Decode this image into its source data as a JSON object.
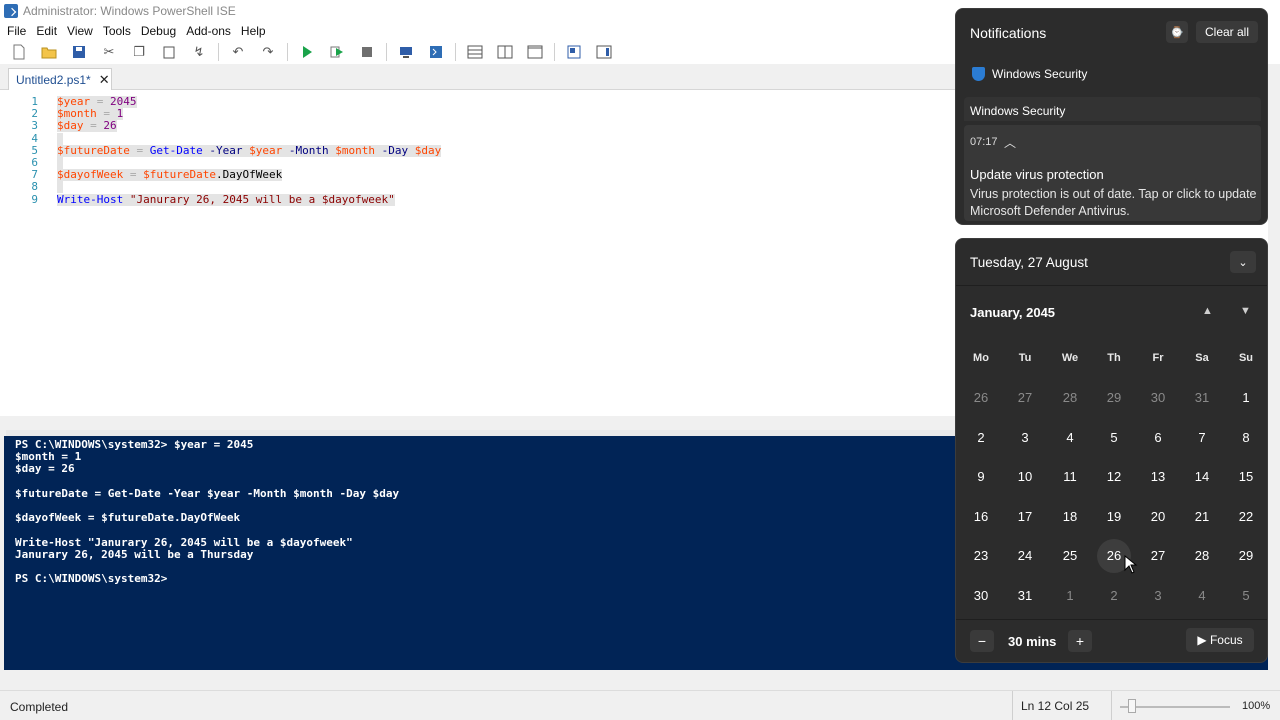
{
  "window": {
    "title": "Administrator: Windows PowerShell ISE"
  },
  "menu": [
    "File",
    "Edit",
    "View",
    "Tools",
    "Debug",
    "Add-ons",
    "Help"
  ],
  "tab": {
    "label": "Untitled2.ps1*",
    "close": "✕"
  },
  "editor": {
    "lines": [
      {
        "n": "1",
        "tokens": [
          [
            "var",
            "$year"
          ],
          [
            "op",
            " = "
          ],
          [
            "num",
            "2045"
          ]
        ]
      },
      {
        "n": "2",
        "tokens": [
          [
            "var",
            "$month"
          ],
          [
            "op",
            " = "
          ],
          [
            "num",
            "1"
          ]
        ]
      },
      {
        "n": "3",
        "tokens": [
          [
            "var",
            "$day"
          ],
          [
            "op",
            " = "
          ],
          [
            "num",
            "26"
          ]
        ]
      },
      {
        "n": "4",
        "tokens": []
      },
      {
        "n": "5",
        "tokens": [
          [
            "var",
            "$futureDate"
          ],
          [
            "op",
            " = "
          ],
          [
            "cmd",
            "Get-Date"
          ],
          [
            "op",
            " "
          ],
          [
            "par",
            "-Year"
          ],
          [
            "op",
            " "
          ],
          [
            "var",
            "$year"
          ],
          [
            "op",
            " "
          ],
          [
            "par",
            "-Month"
          ],
          [
            "op",
            " "
          ],
          [
            "var",
            "$month"
          ],
          [
            "op",
            " "
          ],
          [
            "par",
            "-Day"
          ],
          [
            "op",
            " "
          ],
          [
            "var",
            "$day"
          ]
        ]
      },
      {
        "n": "6",
        "tokens": []
      },
      {
        "n": "7",
        "tokens": [
          [
            "var",
            "$dayofWeek"
          ],
          [
            "op",
            " = "
          ],
          [
            "var",
            "$futureDate"
          ],
          [
            "mem",
            ".DayOfWeek"
          ]
        ]
      },
      {
        "n": "8",
        "tokens": []
      },
      {
        "n": "9",
        "tokens": [
          [
            "cmd",
            "Write-Host"
          ],
          [
            "op",
            " "
          ],
          [
            "str",
            "\"Janurary 26, 2045 will be a $dayofweek\""
          ]
        ]
      }
    ]
  },
  "console": {
    "lines": [
      "PS C:\\WINDOWS\\system32> $year = 2045",
      "$month = 1",
      "$day = 26",
      "",
      "$futureDate = Get-Date -Year $year -Month $month -Day $day",
      "",
      "$dayofWeek = $futureDate.DayOfWeek",
      "",
      "Write-Host \"Janurary 26, 2045 will be a $dayofweek\"",
      "Janurary 26, 2045 will be a Thursday",
      "",
      "PS C:\\WINDOWS\\system32>"
    ]
  },
  "status": {
    "text": "Completed",
    "position": "Ln 12  Col 25",
    "zoom": "100%"
  },
  "notifications": {
    "title": "Notifications",
    "clear_all": "Clear all",
    "app_name": "Windows Security",
    "group_label": "Windows Security",
    "time": "07:17",
    "heading": "Update virus protection",
    "body": "Virus protection is out of date. Tap or click to update Microsoft Defender Antivirus."
  },
  "calendar": {
    "date_header": "Tuesday, 27 August",
    "month_label": "January, 2045",
    "weekdays": [
      "Mo",
      "Tu",
      "We",
      "Th",
      "Fr",
      "Sa",
      "Su"
    ],
    "weeks": [
      [
        [
          "26",
          0
        ],
        [
          "27",
          0
        ],
        [
          "28",
          0
        ],
        [
          "29",
          0
        ],
        [
          "30",
          0
        ],
        [
          "31",
          0
        ],
        [
          "1",
          1
        ]
      ],
      [
        [
          "2",
          1
        ],
        [
          "3",
          1
        ],
        [
          "4",
          1
        ],
        [
          "5",
          1
        ],
        [
          "6",
          1
        ],
        [
          "7",
          1
        ],
        [
          "8",
          1
        ]
      ],
      [
        [
          "9",
          1
        ],
        [
          "10",
          1
        ],
        [
          "11",
          1
        ],
        [
          "12",
          1
        ],
        [
          "13",
          1
        ],
        [
          "14",
          1
        ],
        [
          "15",
          1
        ]
      ],
      [
        [
          "16",
          1
        ],
        [
          "17",
          1
        ],
        [
          "18",
          1
        ],
        [
          "19",
          1
        ],
        [
          "20",
          1
        ],
        [
          "21",
          1
        ],
        [
          "22",
          1
        ]
      ],
      [
        [
          "23",
          1
        ],
        [
          "24",
          1
        ],
        [
          "25",
          1
        ],
        [
          "26",
          1
        ],
        [
          "27",
          1
        ],
        [
          "28",
          1
        ],
        [
          "29",
          1
        ]
      ],
      [
        [
          "30",
          1
        ],
        [
          "31",
          1
        ],
        [
          "1",
          0
        ],
        [
          "2",
          0
        ],
        [
          "3",
          0
        ],
        [
          "4",
          0
        ],
        [
          "5",
          0
        ]
      ]
    ],
    "hovered_day": "26",
    "focus_minus": "−",
    "focus_duration": "30 mins",
    "focus_plus": "+",
    "focus_button": "▶ Focus"
  },
  "colors": {
    "console_bg": "#012456",
    "flyout_bg": "#2c2c2c",
    "accent": "#2b7cd3"
  },
  "icons": [
    "powershell-icon",
    "new-file-icon",
    "open-icon",
    "save-icon",
    "cut-icon",
    "copy-icon",
    "paste-icon",
    "clear-icon",
    "undo-icon",
    "redo-icon",
    "run-icon",
    "run-selection-icon",
    "stop-icon",
    "remote-icon",
    "console-icon",
    "layout-top-icon",
    "layout-right-icon",
    "layout-max-icon",
    "script-pane-icon",
    "commands-icon",
    "shield-icon",
    "dnd-icon",
    "chevron-down-icon"
  ]
}
